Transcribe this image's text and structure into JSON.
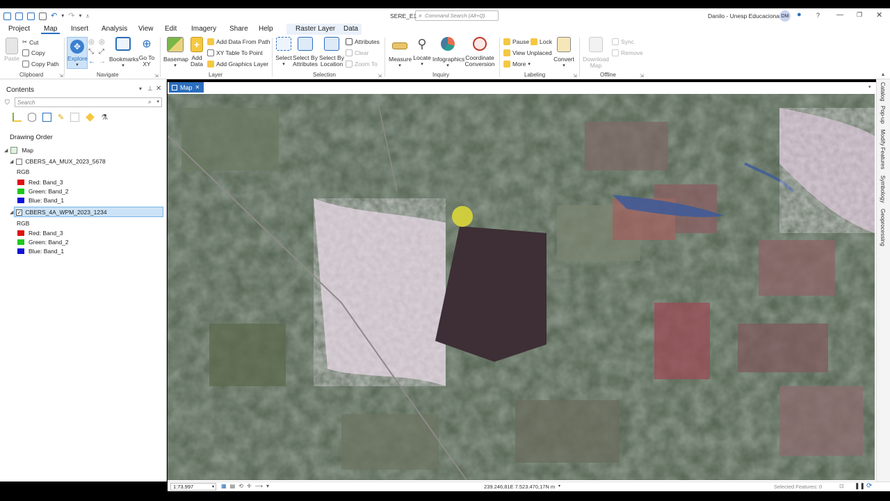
{
  "title_bar": {
    "project_name": "SERE_E1",
    "search_placeholder": "Command Search (Alt+Q)",
    "user_name": "Danilo - Unesp Educacional",
    "user_initials": "DM",
    "help_label": "?"
  },
  "menu": {
    "tabs": [
      "Project",
      "Map",
      "Insert",
      "Analysis",
      "View",
      "Edit",
      "Imagery",
      "Share",
      "Help"
    ],
    "active_tab": "Map",
    "context_tabs": [
      "Raster Layer",
      "Data"
    ]
  },
  "ribbon": {
    "clipboard": {
      "label": "Clipboard",
      "paste": "Paste",
      "cut": "Cut",
      "copy": "Copy",
      "copy_path": "Copy Path"
    },
    "navigate": {
      "label": "Navigate",
      "explore": "Explore",
      "bookmarks": "Bookmarks",
      "go_to_xy": "Go To XY"
    },
    "layer": {
      "label": "Layer",
      "basemap": "Basemap",
      "add_data": "Add Data",
      "add_data_from_path": "Add Data From Path",
      "xy_table_to_point": "XY Table To Point",
      "add_graphics_layer": "Add Graphics Layer"
    },
    "selection": {
      "label": "Selection",
      "select": "Select",
      "select_by_attributes": "Select By Attributes",
      "select_by_location": "Select By Location",
      "attributes": "Attributes",
      "clear": "Clear",
      "zoom_to": "Zoom To"
    },
    "inquiry": {
      "label": "Inquiry",
      "measure": "Measure",
      "locate": "Locate",
      "infographics": "Infographics",
      "coordinate_conversion": "Coordinate Conversion"
    },
    "labeling": {
      "label": "Labeling",
      "pause": "Pause",
      "lock": "Lock",
      "view_unplaced": "View Unplaced",
      "more": "More",
      "convert": "Convert"
    },
    "offline": {
      "label": "Offline",
      "download_map": "Download Map",
      "sync": "Sync",
      "remove": "Remove"
    }
  },
  "contents": {
    "title": "Contents",
    "search_placeholder": "Search",
    "drawing_order": "Drawing Order",
    "map_label": "Map",
    "layers": [
      {
        "name": "CBERS_4A_MUX_2023_5678",
        "checked": false,
        "selected": false,
        "rgb_label": "RGB",
        "bands": [
          {
            "label": "Red: Band_3",
            "color": "#e01010"
          },
          {
            "label": "Green: Band_2",
            "color": "#1ec81e"
          },
          {
            "label": "Blue: Band_1",
            "color": "#1010d8"
          }
        ]
      },
      {
        "name": "CBERS_4A_WPM_2023_1234",
        "checked": true,
        "selected": true,
        "rgb_label": "RGB",
        "bands": [
          {
            "label": "Red: Band_3",
            "color": "#e01010"
          },
          {
            "label": "Green: Band_2",
            "color": "#1ec81e"
          },
          {
            "label": "Blue: Band_1",
            "color": "#1010d8"
          }
        ]
      }
    ]
  },
  "map_view": {
    "tab_label": "Map"
  },
  "right_sidebar": [
    "Catalog",
    "Pop-up",
    "Modify Features",
    "Symbology",
    "Geoprocessing"
  ],
  "status_bar": {
    "scale": "1:73.997",
    "coordinates": "239.246,81E 7.523.470,17N m",
    "selected_features": "Selected Features: 0"
  },
  "colors": {
    "accent": "#2a6ebd",
    "selected_row": "#cce3f7"
  }
}
